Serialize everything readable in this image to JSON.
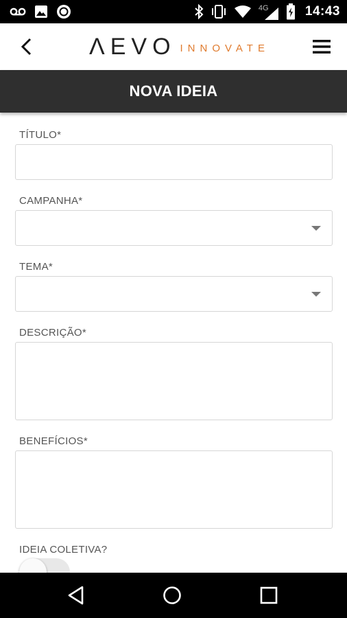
{
  "status_bar": {
    "time": "14:43",
    "network": "4G",
    "left_icons": [
      "voicemail-icon",
      "image-icon",
      "circle-app-icon"
    ],
    "right_icons": [
      "bluetooth-icon",
      "vibrate-icon",
      "wifi-icon",
      "signal-icon",
      "battery-icon"
    ]
  },
  "header": {
    "logo_main": "ΛEVO",
    "logo_sub": "INNOVATE",
    "back_icon": "chevron-left-icon",
    "menu_icon": "hamburger-menu-icon"
  },
  "page": {
    "title": "NOVA IDEIA"
  },
  "form": {
    "titulo_label": "TÍTULO*",
    "campanha_label": "CAMPANHA*",
    "tema_label": "TEMA*",
    "descricao_label": "DESCRIÇÃO*",
    "beneficios_label": "BENEFÍCIOS*",
    "coletiva_label": "IDEIA COLETIVA?",
    "coletiva_value": false
  },
  "nav_bar": {
    "icons": [
      "back-triangle-icon",
      "home-circle-icon",
      "recents-square-icon"
    ]
  },
  "colors": {
    "title_bar": "#2f2f2f",
    "brand_accent": "#e07b2e",
    "field_border": "#d6d6d6"
  }
}
